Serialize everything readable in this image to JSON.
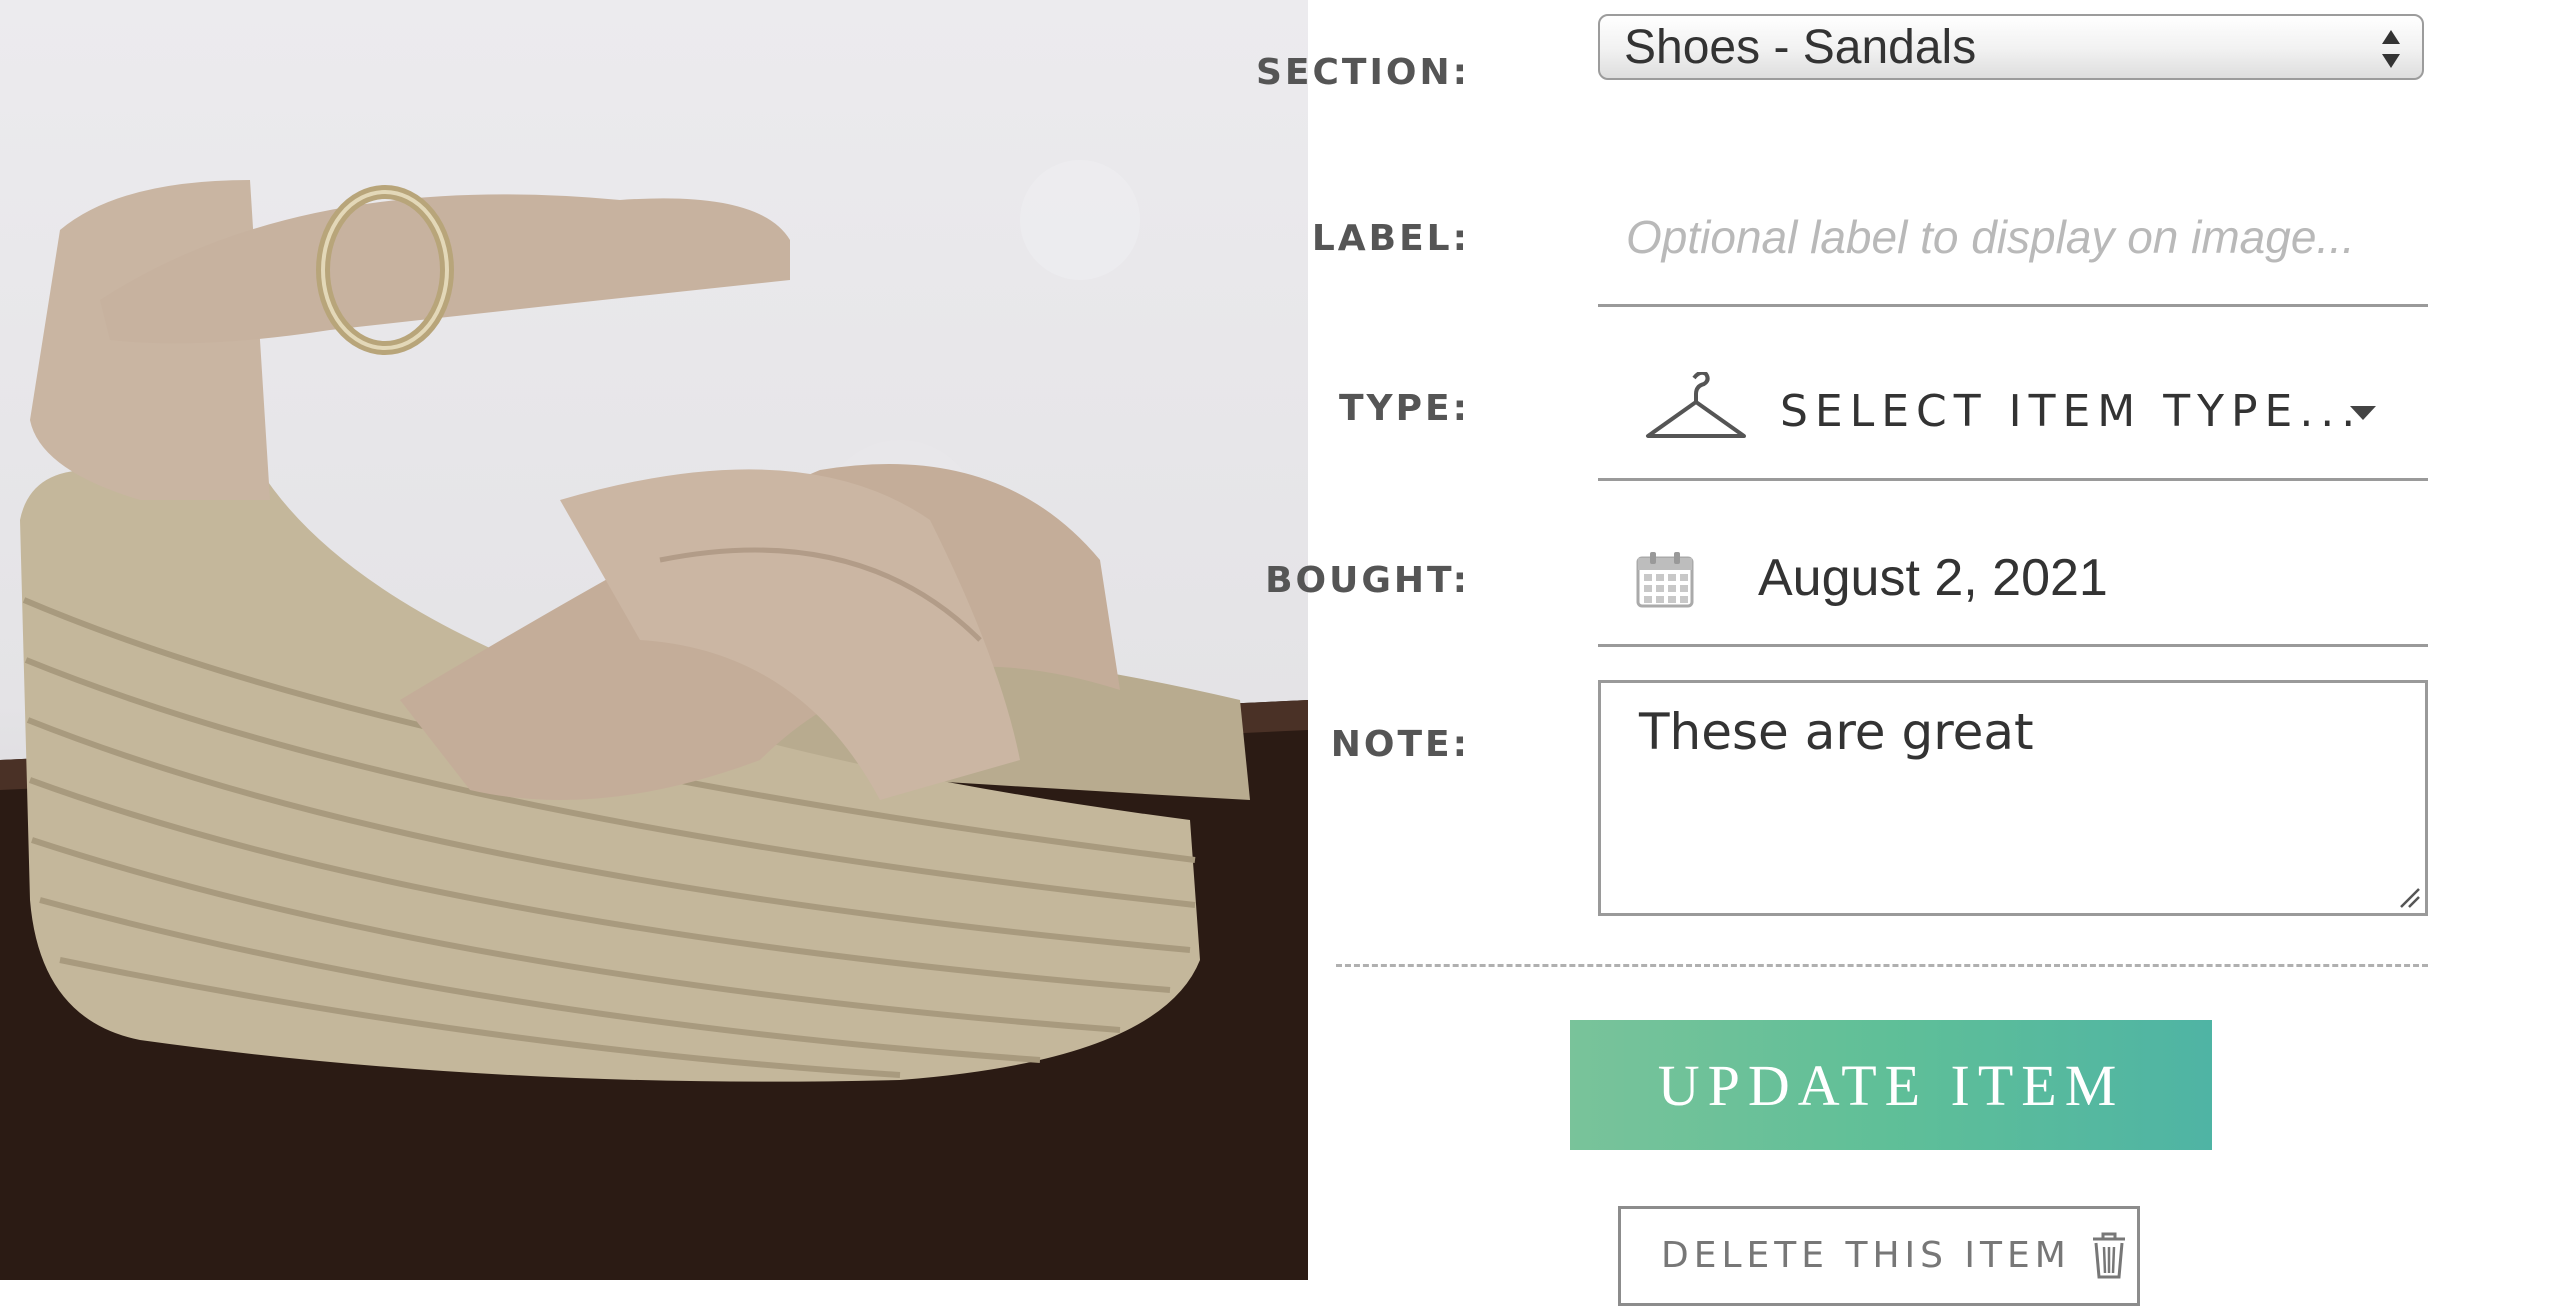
{
  "photo": {
    "alt_icon": "sandal-photo"
  },
  "form": {
    "section": {
      "label": "SECTION:",
      "value": "Shoes - Sandals"
    },
    "label_field": {
      "label": "LABEL:",
      "placeholder": "Optional label to display on image..."
    },
    "type": {
      "label": "TYPE:",
      "value": "SELECT ITEM TYPE...",
      "icon": "hanger-icon"
    },
    "bought": {
      "label": "BOUGHT:",
      "value": "August 2, 2021",
      "icon": "calendar-icon"
    },
    "note": {
      "label": "NOTE:",
      "value": "These are great"
    }
  },
  "actions": {
    "update_label": "UPDATE ITEM",
    "delete_label": "DELETE THIS ITEM",
    "delete_icon": "trash-icon"
  },
  "colors": {
    "update_gradient_start": "#79c39a",
    "update_gradient_end": "#4fb4a4"
  }
}
